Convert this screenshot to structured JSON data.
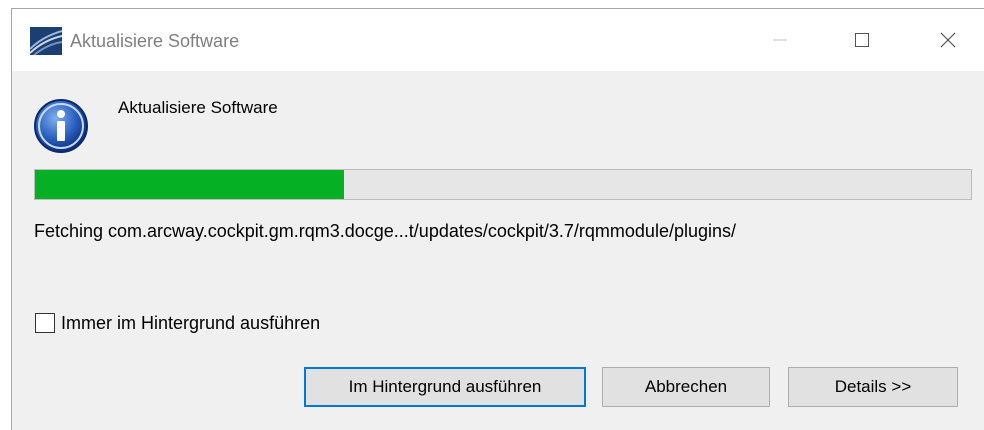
{
  "window": {
    "title": "Aktualisiere Software"
  },
  "dialog": {
    "message": "Aktualisiere Software",
    "progress_fraction": 0.33,
    "status_text": "Fetching com.arcway.cockpit.gm.rqm3.docge...t/updates/cockpit/3.7/rqmmodule/plugins/",
    "checkbox": {
      "label": "Immer im Hintergrund ausführen",
      "checked": false
    },
    "buttons": {
      "background_label": "Im Hintergrund ausführen",
      "cancel_label": "Abbrechen",
      "details_label": "Details >>"
    }
  },
  "colors": {
    "progress_fill": "#06b025",
    "progress_track": "#e6e6e6",
    "default_button_border": "#0078d7",
    "dialog_background": "#f0f0f0"
  },
  "icons": {
    "app": "eclipse-app-icon",
    "message": "info-icon",
    "minimize": "minimize-icon",
    "maximize": "maximize-icon",
    "close": "close-icon"
  }
}
